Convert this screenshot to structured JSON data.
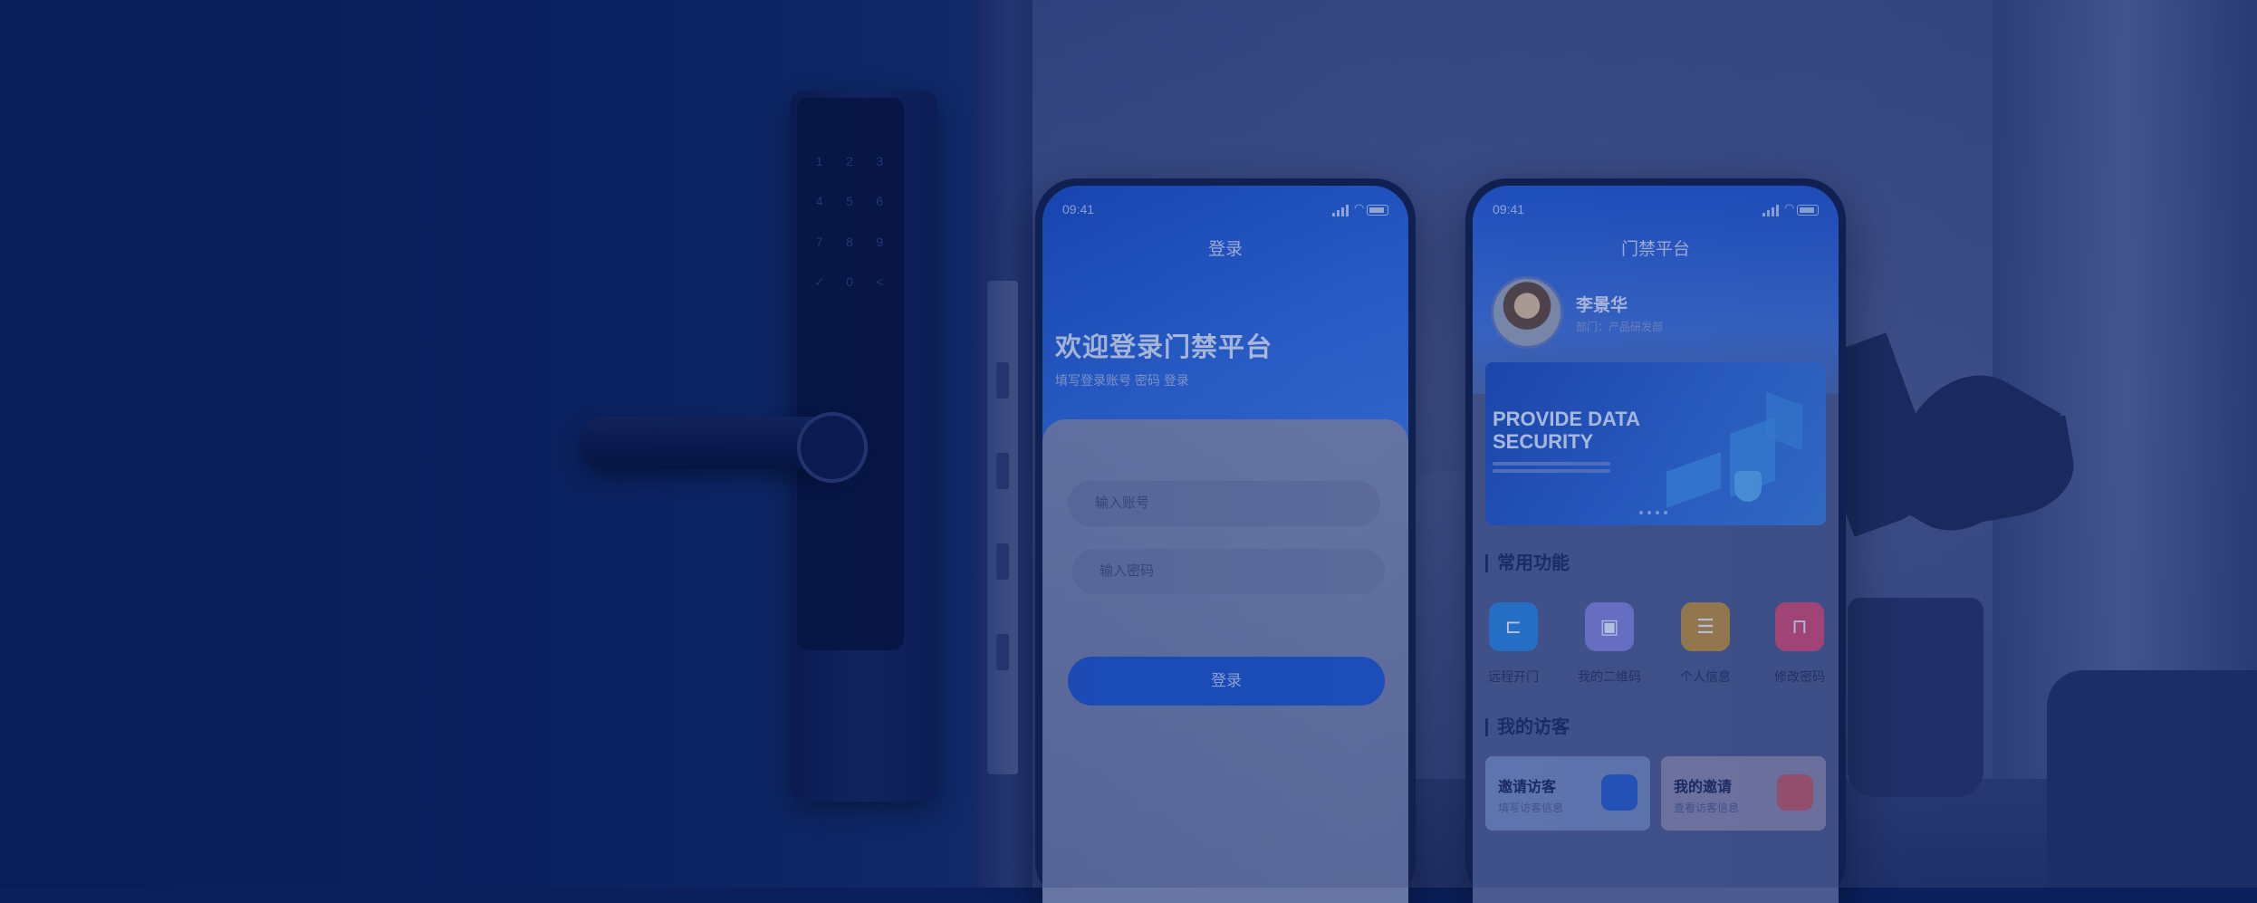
{
  "phone_login": {
    "status_time": "09:41",
    "nav_title": "登录",
    "welcome_title": "欢迎登录门禁平台",
    "welcome_subtitle": "填写登录账号 密码 登录",
    "account_placeholder": "输入账号",
    "password_placeholder": "输入密码",
    "login_button": "登录"
  },
  "phone_home": {
    "status_time": "09:41",
    "nav_title": "门禁平台",
    "user_name": "李景华",
    "user_department": "部门：产品研发部",
    "banner_title": "PROVIDE DATA SECURITY",
    "section_common": "常用功能",
    "functions": [
      {
        "label": "远程开门",
        "icon": "door-icon",
        "color": "#2a7fd9"
      },
      {
        "label": "我的二维码",
        "icon": "qrcode-user-icon",
        "color": "#7b7fd8"
      },
      {
        "label": "个人信息",
        "icon": "person-card-icon",
        "color": "#b28a4a"
      },
      {
        "label": "修改密码",
        "icon": "lock-icon",
        "color": "#c64d7d"
      }
    ],
    "section_visitors": "我的访客",
    "visitor_cards": [
      {
        "title": "邀请访客",
        "subtitle": "填写访客信息",
        "icon": "invite-person-icon"
      },
      {
        "title": "我的邀请",
        "subtitle": "查看访客信息",
        "icon": "briefcase-icon"
      }
    ]
  },
  "lock": {
    "keypad_keys": [
      "1",
      "2",
      "3",
      "4",
      "5",
      "6",
      "7",
      "8",
      "9",
      "✓",
      "0",
      "<"
    ]
  },
  "colors": {
    "overlay_blue": "#0a1f5c",
    "primary_blue": "#1f55c8"
  }
}
